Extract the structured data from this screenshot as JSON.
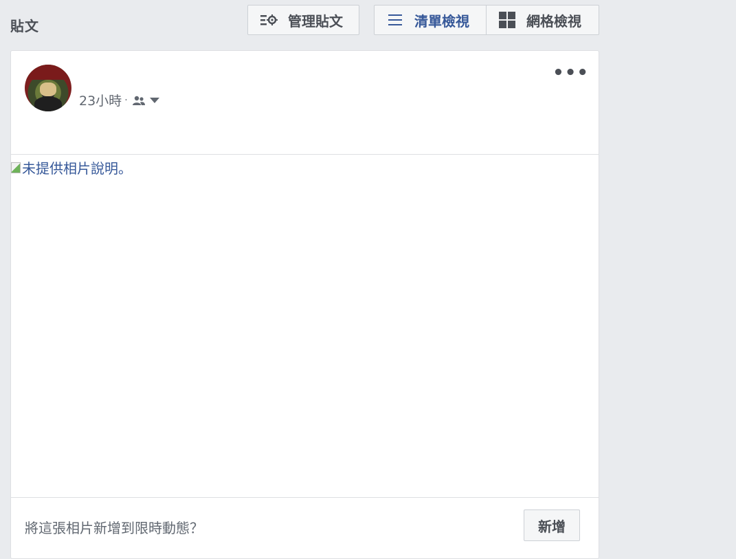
{
  "page": {
    "title": "貼文"
  },
  "toolbar": {
    "manage_label": "管理貼文",
    "list_view_label": "清單檢視",
    "grid_view_label": "網格檢視",
    "active_view": "list",
    "active_color": "#365899"
  },
  "post": {
    "timestamp": "23小時",
    "separator": "·",
    "privacy_icon": "friends-icon",
    "more_icon": "more-options-icon",
    "more_label": "•••",
    "image_alt": "未提供相片說明。"
  },
  "story": {
    "prompt": "將這張相片新增到限時動態？",
    "add_label": "新增"
  },
  "colors": {
    "background": "#e9ebee",
    "card": "#ffffff",
    "link": "#365899",
    "border": "#ccd0d5"
  }
}
